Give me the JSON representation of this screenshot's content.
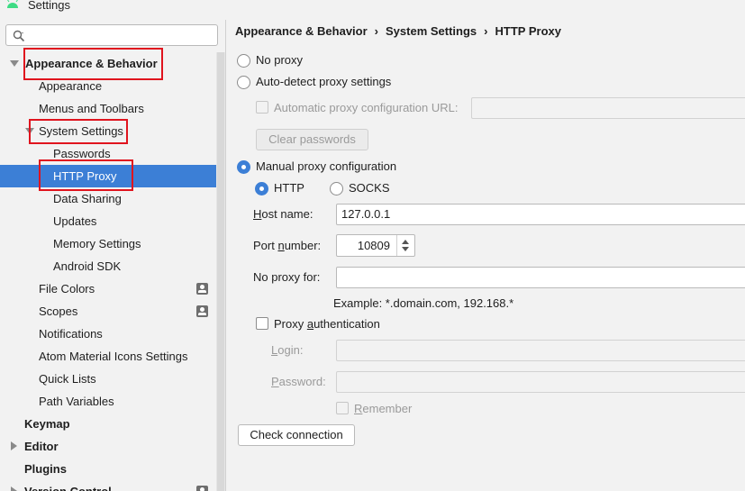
{
  "window": {
    "title": "Settings"
  },
  "search": {
    "placeholder": "",
    "value": ""
  },
  "tree": {
    "appearance_behavior": "Appearance & Behavior",
    "appearance": "Appearance",
    "menus_toolbars": "Menus and Toolbars",
    "system_settings": "System Settings",
    "passwords": "Passwords",
    "http_proxy": "HTTP Proxy",
    "data_sharing": "Data Sharing",
    "updates": "Updates",
    "memory_settings": "Memory Settings",
    "android_sdk": "Android SDK",
    "file_colors": "File Colors",
    "scopes": "Scopes",
    "notifications": "Notifications",
    "atom_icons": "Atom Material Icons Settings",
    "quick_lists": "Quick Lists",
    "path_variables": "Path Variables",
    "keymap": "Keymap",
    "editor": "Editor",
    "plugins": "Plugins",
    "version_control": "Version Control"
  },
  "breadcrumb": {
    "item1": "Appearance & Behavior",
    "sep": "›",
    "item2": "System Settings",
    "item3": "HTTP Proxy"
  },
  "proxy": {
    "no_proxy": "No proxy",
    "auto_detect": "Auto-detect proxy settings",
    "auto_config_url_label": "Automatic proxy configuration URL:",
    "auto_config_url_value": "",
    "clear_passwords": "Clear passwords",
    "manual": "Manual proxy configuration",
    "http": "HTTP",
    "socks": "SOCKS",
    "host_label_pre": "H",
    "host_label_post": "ost name:",
    "host_value": "127.0.0.1",
    "port_label_pre": "Port ",
    "port_label_u": "n",
    "port_label_post": "umber:",
    "port_value": "10809",
    "no_proxy_for_label": "No proxy for:",
    "no_proxy_for_value": "",
    "example": "Example: *.domain.com, 192.168.*",
    "proxy_auth_pre": "Proxy ",
    "proxy_auth_u": "a",
    "proxy_auth_post": "uthentication",
    "login_u": "L",
    "login_post": "ogin:",
    "login_value": "",
    "password_u": "P",
    "password_post": "assword:",
    "password_value": "",
    "remember_u": "R",
    "remember_post": "emember",
    "check_connection": "Check connection"
  },
  "colors": {
    "selection": "#3c7fd6",
    "highlight_box": "#e0141e",
    "android_green": "#3ddc84"
  }
}
